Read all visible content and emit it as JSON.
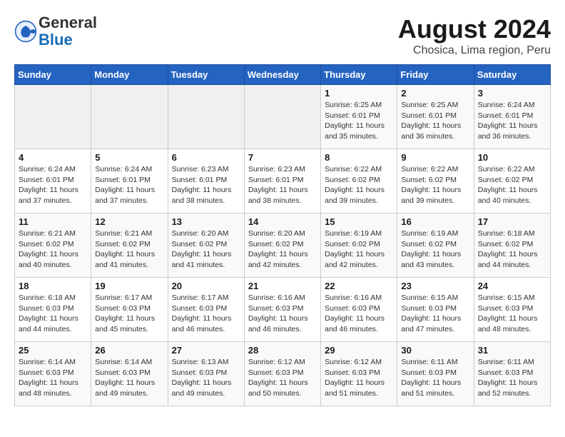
{
  "header": {
    "logo_line1": "General",
    "logo_line2": "Blue",
    "month_year": "August 2024",
    "location": "Chosica, Lima region, Peru"
  },
  "weekdays": [
    "Sunday",
    "Monday",
    "Tuesday",
    "Wednesday",
    "Thursday",
    "Friday",
    "Saturday"
  ],
  "weeks": [
    [
      {
        "day": "",
        "info": ""
      },
      {
        "day": "",
        "info": ""
      },
      {
        "day": "",
        "info": ""
      },
      {
        "day": "",
        "info": ""
      },
      {
        "day": "1",
        "info": "Sunrise: 6:25 AM\nSunset: 6:01 PM\nDaylight: 11 hours\nand 35 minutes."
      },
      {
        "day": "2",
        "info": "Sunrise: 6:25 AM\nSunset: 6:01 PM\nDaylight: 11 hours\nand 36 minutes."
      },
      {
        "day": "3",
        "info": "Sunrise: 6:24 AM\nSunset: 6:01 PM\nDaylight: 11 hours\nand 36 minutes."
      }
    ],
    [
      {
        "day": "4",
        "info": "Sunrise: 6:24 AM\nSunset: 6:01 PM\nDaylight: 11 hours\nand 37 minutes."
      },
      {
        "day": "5",
        "info": "Sunrise: 6:24 AM\nSunset: 6:01 PM\nDaylight: 11 hours\nand 37 minutes."
      },
      {
        "day": "6",
        "info": "Sunrise: 6:23 AM\nSunset: 6:01 PM\nDaylight: 11 hours\nand 38 minutes."
      },
      {
        "day": "7",
        "info": "Sunrise: 6:23 AM\nSunset: 6:01 PM\nDaylight: 11 hours\nand 38 minutes."
      },
      {
        "day": "8",
        "info": "Sunrise: 6:22 AM\nSunset: 6:02 PM\nDaylight: 11 hours\nand 39 minutes."
      },
      {
        "day": "9",
        "info": "Sunrise: 6:22 AM\nSunset: 6:02 PM\nDaylight: 11 hours\nand 39 minutes."
      },
      {
        "day": "10",
        "info": "Sunrise: 6:22 AM\nSunset: 6:02 PM\nDaylight: 11 hours\nand 40 minutes."
      }
    ],
    [
      {
        "day": "11",
        "info": "Sunrise: 6:21 AM\nSunset: 6:02 PM\nDaylight: 11 hours\nand 40 minutes."
      },
      {
        "day": "12",
        "info": "Sunrise: 6:21 AM\nSunset: 6:02 PM\nDaylight: 11 hours\nand 41 minutes."
      },
      {
        "day": "13",
        "info": "Sunrise: 6:20 AM\nSunset: 6:02 PM\nDaylight: 11 hours\nand 41 minutes."
      },
      {
        "day": "14",
        "info": "Sunrise: 6:20 AM\nSunset: 6:02 PM\nDaylight: 11 hours\nand 42 minutes."
      },
      {
        "day": "15",
        "info": "Sunrise: 6:19 AM\nSunset: 6:02 PM\nDaylight: 11 hours\nand 42 minutes."
      },
      {
        "day": "16",
        "info": "Sunrise: 6:19 AM\nSunset: 6:02 PM\nDaylight: 11 hours\nand 43 minutes."
      },
      {
        "day": "17",
        "info": "Sunrise: 6:18 AM\nSunset: 6:02 PM\nDaylight: 11 hours\nand 44 minutes."
      }
    ],
    [
      {
        "day": "18",
        "info": "Sunrise: 6:18 AM\nSunset: 6:03 PM\nDaylight: 11 hours\nand 44 minutes."
      },
      {
        "day": "19",
        "info": "Sunrise: 6:17 AM\nSunset: 6:03 PM\nDaylight: 11 hours\nand 45 minutes."
      },
      {
        "day": "20",
        "info": "Sunrise: 6:17 AM\nSunset: 6:03 PM\nDaylight: 11 hours\nand 46 minutes."
      },
      {
        "day": "21",
        "info": "Sunrise: 6:16 AM\nSunset: 6:03 PM\nDaylight: 11 hours\nand 46 minutes."
      },
      {
        "day": "22",
        "info": "Sunrise: 6:16 AM\nSunset: 6:03 PM\nDaylight: 11 hours\nand 46 minutes."
      },
      {
        "day": "23",
        "info": "Sunrise: 6:15 AM\nSunset: 6:03 PM\nDaylight: 11 hours\nand 47 minutes."
      },
      {
        "day": "24",
        "info": "Sunrise: 6:15 AM\nSunset: 6:03 PM\nDaylight: 11 hours\nand 48 minutes."
      }
    ],
    [
      {
        "day": "25",
        "info": "Sunrise: 6:14 AM\nSunset: 6:03 PM\nDaylight: 11 hours\nand 48 minutes."
      },
      {
        "day": "26",
        "info": "Sunrise: 6:14 AM\nSunset: 6:03 PM\nDaylight: 11 hours\nand 49 minutes."
      },
      {
        "day": "27",
        "info": "Sunrise: 6:13 AM\nSunset: 6:03 PM\nDaylight: 11 hours\nand 49 minutes."
      },
      {
        "day": "28",
        "info": "Sunrise: 6:12 AM\nSunset: 6:03 PM\nDaylight: 11 hours\nand 50 minutes."
      },
      {
        "day": "29",
        "info": "Sunrise: 6:12 AM\nSunset: 6:03 PM\nDaylight: 11 hours\nand 51 minutes."
      },
      {
        "day": "30",
        "info": "Sunrise: 6:11 AM\nSunset: 6:03 PM\nDaylight: 11 hours\nand 51 minutes."
      },
      {
        "day": "31",
        "info": "Sunrise: 6:11 AM\nSunset: 6:03 PM\nDaylight: 11 hours\nand 52 minutes."
      }
    ]
  ]
}
